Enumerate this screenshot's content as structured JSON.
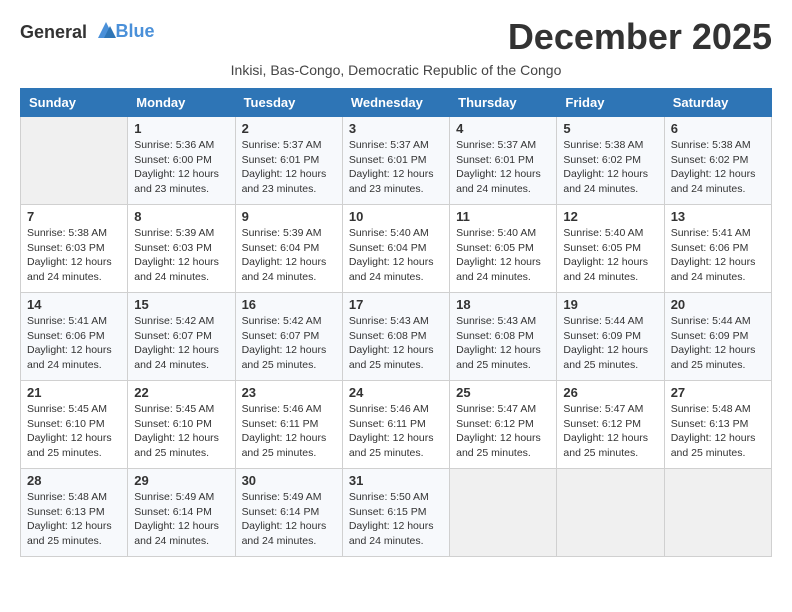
{
  "logo": {
    "general": "General",
    "blue": "Blue"
  },
  "title": "December 2025",
  "subtitle": "Inkisi, Bas-Congo, Democratic Republic of the Congo",
  "weekdays": [
    "Sunday",
    "Monday",
    "Tuesday",
    "Wednesday",
    "Thursday",
    "Friday",
    "Saturday"
  ],
  "weeks": [
    [
      {
        "day": "",
        "info": ""
      },
      {
        "day": "1",
        "info": "Sunrise: 5:36 AM\nSunset: 6:00 PM\nDaylight: 12 hours\nand 23 minutes."
      },
      {
        "day": "2",
        "info": "Sunrise: 5:37 AM\nSunset: 6:01 PM\nDaylight: 12 hours\nand 23 minutes."
      },
      {
        "day": "3",
        "info": "Sunrise: 5:37 AM\nSunset: 6:01 PM\nDaylight: 12 hours\nand 23 minutes."
      },
      {
        "day": "4",
        "info": "Sunrise: 5:37 AM\nSunset: 6:01 PM\nDaylight: 12 hours\nand 24 minutes."
      },
      {
        "day": "5",
        "info": "Sunrise: 5:38 AM\nSunset: 6:02 PM\nDaylight: 12 hours\nand 24 minutes."
      },
      {
        "day": "6",
        "info": "Sunrise: 5:38 AM\nSunset: 6:02 PM\nDaylight: 12 hours\nand 24 minutes."
      }
    ],
    [
      {
        "day": "7",
        "info": "Sunrise: 5:38 AM\nSunset: 6:03 PM\nDaylight: 12 hours\nand 24 minutes."
      },
      {
        "day": "8",
        "info": "Sunrise: 5:39 AM\nSunset: 6:03 PM\nDaylight: 12 hours\nand 24 minutes."
      },
      {
        "day": "9",
        "info": "Sunrise: 5:39 AM\nSunset: 6:04 PM\nDaylight: 12 hours\nand 24 minutes."
      },
      {
        "day": "10",
        "info": "Sunrise: 5:40 AM\nSunset: 6:04 PM\nDaylight: 12 hours\nand 24 minutes."
      },
      {
        "day": "11",
        "info": "Sunrise: 5:40 AM\nSunset: 6:05 PM\nDaylight: 12 hours\nand 24 minutes."
      },
      {
        "day": "12",
        "info": "Sunrise: 5:40 AM\nSunset: 6:05 PM\nDaylight: 12 hours\nand 24 minutes."
      },
      {
        "day": "13",
        "info": "Sunrise: 5:41 AM\nSunset: 6:06 PM\nDaylight: 12 hours\nand 24 minutes."
      }
    ],
    [
      {
        "day": "14",
        "info": "Sunrise: 5:41 AM\nSunset: 6:06 PM\nDaylight: 12 hours\nand 24 minutes."
      },
      {
        "day": "15",
        "info": "Sunrise: 5:42 AM\nSunset: 6:07 PM\nDaylight: 12 hours\nand 24 minutes."
      },
      {
        "day": "16",
        "info": "Sunrise: 5:42 AM\nSunset: 6:07 PM\nDaylight: 12 hours\nand 25 minutes."
      },
      {
        "day": "17",
        "info": "Sunrise: 5:43 AM\nSunset: 6:08 PM\nDaylight: 12 hours\nand 25 minutes."
      },
      {
        "day": "18",
        "info": "Sunrise: 5:43 AM\nSunset: 6:08 PM\nDaylight: 12 hours\nand 25 minutes."
      },
      {
        "day": "19",
        "info": "Sunrise: 5:44 AM\nSunset: 6:09 PM\nDaylight: 12 hours\nand 25 minutes."
      },
      {
        "day": "20",
        "info": "Sunrise: 5:44 AM\nSunset: 6:09 PM\nDaylight: 12 hours\nand 25 minutes."
      }
    ],
    [
      {
        "day": "21",
        "info": "Sunrise: 5:45 AM\nSunset: 6:10 PM\nDaylight: 12 hours\nand 25 minutes."
      },
      {
        "day": "22",
        "info": "Sunrise: 5:45 AM\nSunset: 6:10 PM\nDaylight: 12 hours\nand 25 minutes."
      },
      {
        "day": "23",
        "info": "Sunrise: 5:46 AM\nSunset: 6:11 PM\nDaylight: 12 hours\nand 25 minutes."
      },
      {
        "day": "24",
        "info": "Sunrise: 5:46 AM\nSunset: 6:11 PM\nDaylight: 12 hours\nand 25 minutes."
      },
      {
        "day": "25",
        "info": "Sunrise: 5:47 AM\nSunset: 6:12 PM\nDaylight: 12 hours\nand 25 minutes."
      },
      {
        "day": "26",
        "info": "Sunrise: 5:47 AM\nSunset: 6:12 PM\nDaylight: 12 hours\nand 25 minutes."
      },
      {
        "day": "27",
        "info": "Sunrise: 5:48 AM\nSunset: 6:13 PM\nDaylight: 12 hours\nand 25 minutes."
      }
    ],
    [
      {
        "day": "28",
        "info": "Sunrise: 5:48 AM\nSunset: 6:13 PM\nDaylight: 12 hours\nand 25 minutes."
      },
      {
        "day": "29",
        "info": "Sunrise: 5:49 AM\nSunset: 6:14 PM\nDaylight: 12 hours\nand 24 minutes."
      },
      {
        "day": "30",
        "info": "Sunrise: 5:49 AM\nSunset: 6:14 PM\nDaylight: 12 hours\nand 24 minutes."
      },
      {
        "day": "31",
        "info": "Sunrise: 5:50 AM\nSunset: 6:15 PM\nDaylight: 12 hours\nand 24 minutes."
      },
      {
        "day": "",
        "info": ""
      },
      {
        "day": "",
        "info": ""
      },
      {
        "day": "",
        "info": ""
      }
    ]
  ]
}
